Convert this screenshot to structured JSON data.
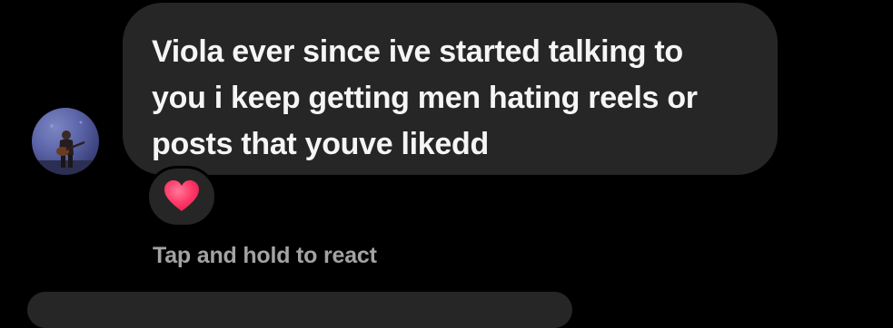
{
  "message": {
    "text": "Viola ever since ive started talking to\nyou i keep getting men hating reels or\nposts that youve likedd"
  },
  "reaction": {
    "icon": "heart-icon",
    "color": "#ff3b6b"
  },
  "hint": {
    "text": "Tap and hold to react"
  },
  "avatar": {
    "icon": "profile-photo-guitarist"
  },
  "colors": {
    "background": "#000000",
    "bubble": "#262626",
    "message_text": "#f5f5f5",
    "hint_text": "#a3a3a3"
  }
}
